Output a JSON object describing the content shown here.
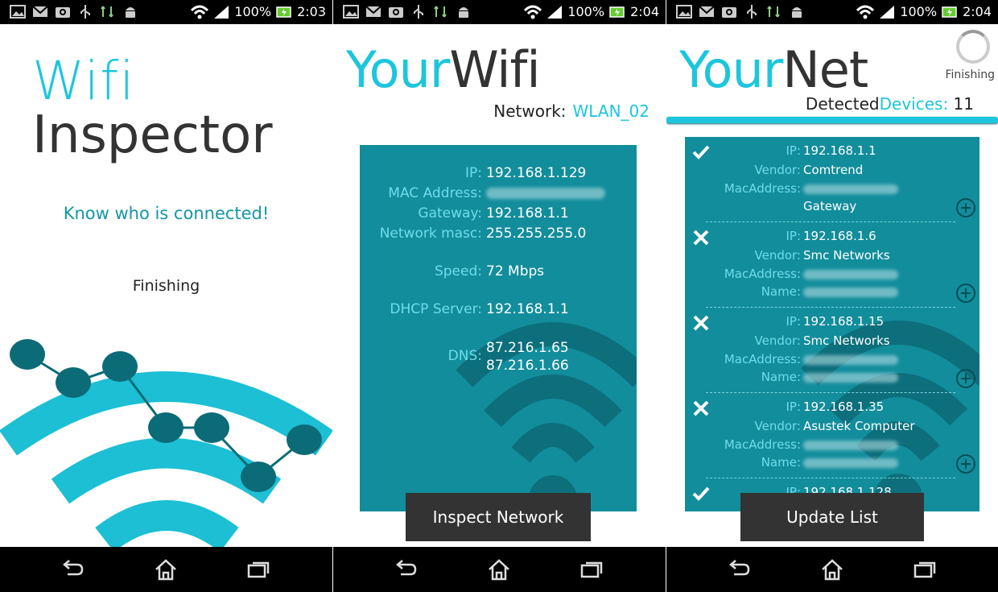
{
  "status_bar": [
    {
      "battery": "100%",
      "time": "2:03"
    },
    {
      "battery": "100%",
      "time": "2:04"
    },
    {
      "battery": "100%",
      "time": "2:04"
    }
  ],
  "screen1": {
    "title_line1": "Wifi",
    "title_line2": "Inspector",
    "tagline": "Know who is connected!",
    "status": "Finishing"
  },
  "screen2": {
    "logo_part1": "Your",
    "logo_part2": "Wifi",
    "network_label": "Network:",
    "network_value": "WLAN_02",
    "info": {
      "ip_label": "IP:",
      "ip": "192.168.1.129",
      "mac_label": "MAC Address:",
      "gateway_label": "Gateway:",
      "gateway": "192.168.1.1",
      "mask_label": "Network masc:",
      "mask": "255.255.255.0",
      "speed_label": "Speed:",
      "speed": "72 Mbps",
      "dhcp_label": "DHCP Server:",
      "dhcp": "192.168.1.1",
      "dns_label": "DNS:",
      "dns1": "87.216.1.65",
      "dns2": "87.216.1.66"
    },
    "button": "Inspect Network"
  },
  "screen3": {
    "logo_part1": "Your",
    "logo_part2": "Net",
    "spinner_label": "Finishing",
    "detected_label_1": "Detected",
    "detected_label_2": "Devices:",
    "detected_count": "11",
    "labels": {
      "ip": "IP:",
      "vendor": "Vendor:",
      "mac": "MacAddress:",
      "name": "Name:"
    },
    "devices": [
      {
        "status": "check",
        "ip": "192.168.1.1",
        "vendor": "Comtrend",
        "extra": "Gateway"
      },
      {
        "status": "cross",
        "ip": "192.168.1.6",
        "vendor": "Smc Networks"
      },
      {
        "status": "cross",
        "ip": "192.168.1.15",
        "vendor": "Smc Networks"
      },
      {
        "status": "cross",
        "ip": "192.168.1.35",
        "vendor": "Asustek Computer"
      },
      {
        "status": "check",
        "ip": "192.168.1.128"
      }
    ],
    "button": "Update List"
  },
  "colors": {
    "accent": "#1cc6dc",
    "card": "#128d9c",
    "button": "#333333",
    "node": "#0b6b77"
  },
  "icons": [
    "gallery-icon",
    "email-icon",
    "camera-icon",
    "usb-icon",
    "data-sync-icon",
    "android-icon",
    "wifi-icon",
    "signal-icon",
    "battery-icon",
    "back-icon",
    "home-icon",
    "recent-apps-icon",
    "check-icon",
    "cross-icon",
    "add-circle-icon"
  ]
}
